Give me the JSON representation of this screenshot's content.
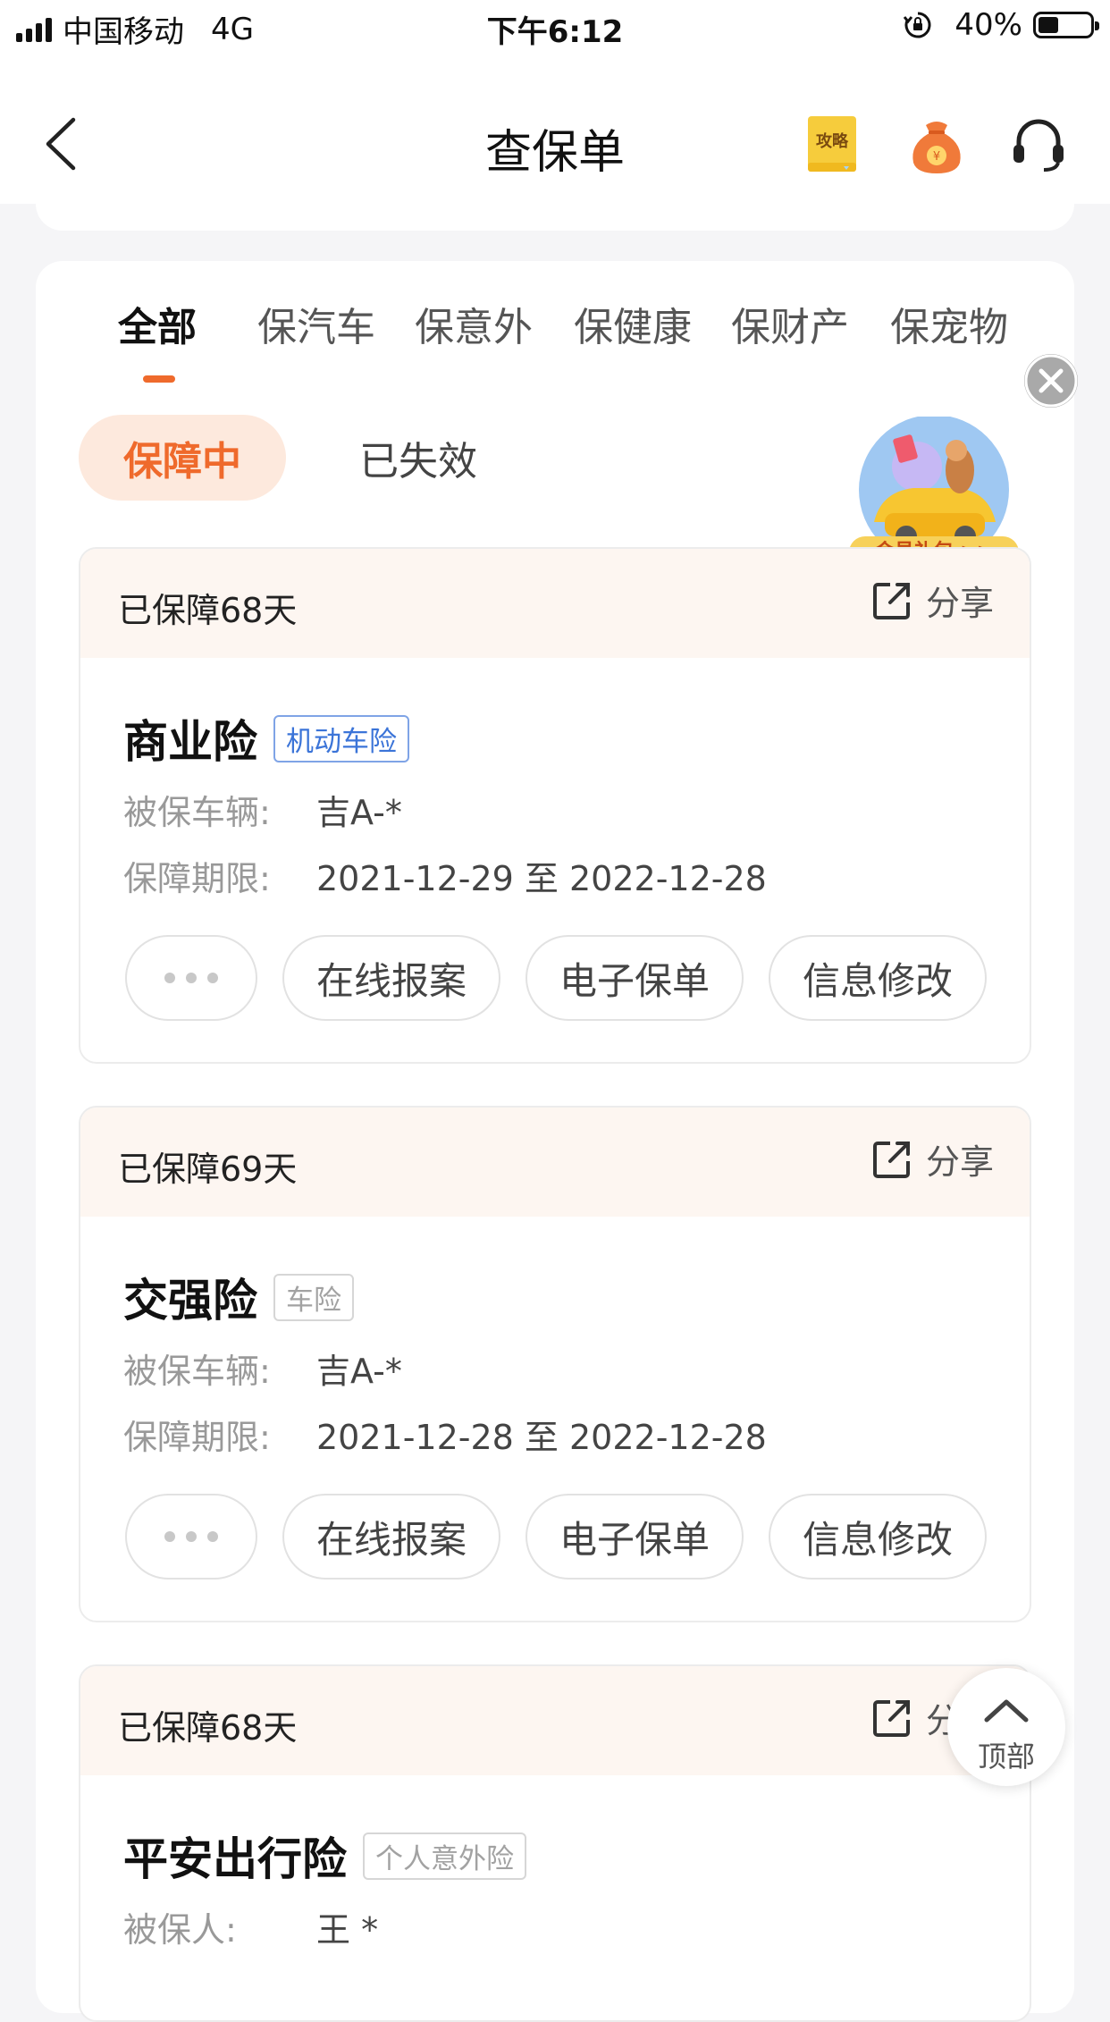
{
  "status_bar": {
    "carrier": "中国移动",
    "network": "4G",
    "time": "下午6:12",
    "battery": "40%",
    "battery_level": 0.4
  },
  "nav": {
    "title": "查保单",
    "strategy_icon_text": "攻略"
  },
  "tabs": [
    "全部",
    "保汽车",
    "保意外",
    "保健康",
    "保财产",
    "保宠物"
  ],
  "active_tab": "全部",
  "status_filters": {
    "active": "保障中",
    "inactive": "已失效"
  },
  "promo": {
    "label": "会员礼包 >>"
  },
  "policies": [
    {
      "days": "已保障68天",
      "share": "分享",
      "name": "商业险",
      "tag": "机动车险",
      "row1_label": "被保车辆:",
      "row1_value": "吉A-*",
      "row2_label": "保障期限:",
      "row2_value": "2021-12-29 至 2022-12-28",
      "buttons": [
        "在线报案",
        "电子保单",
        "信息修改"
      ]
    },
    {
      "days": "已保障69天",
      "share": "分享",
      "name": "交强险",
      "tag": "车险",
      "row1_label": "被保车辆:",
      "row1_value": "吉A-*",
      "row2_label": "保障期限:",
      "row2_value": "2021-12-28 至 2022-12-28",
      "buttons": [
        "在线报案",
        "电子保单",
        "信息修改"
      ]
    },
    {
      "days": "已保障68天",
      "share": "分享",
      "name": "平安出行险",
      "tag": "个人意外险",
      "row1_label": "被保人:",
      "row1_value": "王 *"
    }
  ],
  "back_to_top": "顶部",
  "colors": {
    "accent": "#ef6a2c",
    "pill_bg": "#fde9dd",
    "card_header_bg": "#fdf6f1",
    "tag_blue": "#3b74d8"
  }
}
